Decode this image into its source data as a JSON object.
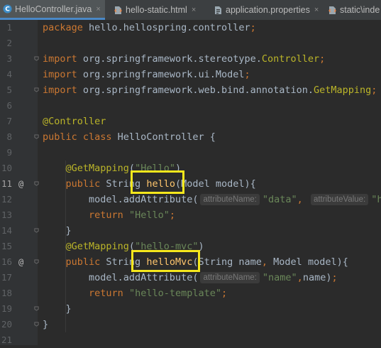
{
  "tabs": [
    {
      "label": "HelloController.java",
      "icon": "java-class-icon",
      "active": true
    },
    {
      "label": "hello-static.html",
      "icon": "html-file-icon",
      "active": false
    },
    {
      "label": "application.properties",
      "icon": "properties-file-icon",
      "active": false
    },
    {
      "label": "static\\inde",
      "icon": "html-file-icon",
      "active": false
    }
  ],
  "close_glyph": "×",
  "gutter_marker": "@",
  "colors": {
    "background": "#2b2b2b",
    "gutter": "#313335",
    "keyword": "#cc7832",
    "annotation": "#bbb529",
    "string": "#6a8759",
    "highlight_box": "#f5e71c",
    "active_tab_underline": "#4a88c7"
  },
  "lines": [
    {
      "n": "1",
      "tokens": [
        {
          "t": "package ",
          "c": "kw"
        },
        {
          "t": "hello.hellospring.controller",
          "c": ""
        },
        {
          "t": ";",
          "c": "kw"
        }
      ]
    },
    {
      "n": "2",
      "tokens": []
    },
    {
      "n": "3",
      "tokens": [
        {
          "t": "import ",
          "c": "kw"
        },
        {
          "t": "org.springframework.stereotype.",
          "c": ""
        },
        {
          "t": "Controller",
          "c": "ann"
        },
        {
          "t": ";",
          "c": "kw"
        }
      ]
    },
    {
      "n": "4",
      "tokens": [
        {
          "t": "import ",
          "c": "kw"
        },
        {
          "t": "org.springframework.ui.Model",
          "c": ""
        },
        {
          "t": ";",
          "c": "kw"
        }
      ]
    },
    {
      "n": "5",
      "tokens": [
        {
          "t": "import ",
          "c": "kw"
        },
        {
          "t": "org.springframework.web.bind.annotation.",
          "c": ""
        },
        {
          "t": "GetMapping",
          "c": "ann"
        },
        {
          "t": ";",
          "c": "kw"
        }
      ]
    },
    {
      "n": "6",
      "tokens": []
    },
    {
      "n": "7",
      "tokens": [
        {
          "t": "@Controller",
          "c": "ann"
        }
      ]
    },
    {
      "n": "8",
      "tokens": [
        {
          "t": "public class ",
          "c": "kw"
        },
        {
          "t": "HelloController ",
          "c": ""
        },
        {
          "t": "{",
          "c": ""
        }
      ]
    },
    {
      "n": "9",
      "tokens": []
    },
    {
      "n": "10",
      "tokens": [
        {
          "t": "    ",
          "c": ""
        },
        {
          "t": "@GetMapping",
          "c": "ann"
        },
        {
          "t": "(",
          "c": ""
        },
        {
          "t": "\"Hello\"",
          "c": "str"
        },
        {
          "t": ")",
          "c": ""
        }
      ]
    },
    {
      "n": "11",
      "tokens": [
        {
          "t": "    ",
          "c": ""
        },
        {
          "t": "public ",
          "c": "kw"
        },
        {
          "t": "String ",
          "c": ""
        },
        {
          "t": "hello",
          "c": "meth"
        },
        {
          "t": "(Model model){",
          "c": ""
        }
      ]
    },
    {
      "n": "12",
      "tokens": [
        {
          "t": "        model.addAttribute(",
          "c": ""
        },
        {
          "hint": "attributeName:"
        },
        {
          "t": "\"data\"",
          "c": "str"
        },
        {
          "t": ", ",
          "c": "kw"
        },
        {
          "hint": "attributeValue:"
        },
        {
          "t": "\"h",
          "c": "str"
        }
      ]
    },
    {
      "n": "13",
      "tokens": [
        {
          "t": "        ",
          "c": ""
        },
        {
          "t": "return ",
          "c": "kw"
        },
        {
          "t": "\"Hello\"",
          "c": "str"
        },
        {
          "t": ";",
          "c": "kw"
        }
      ]
    },
    {
      "n": "14",
      "tokens": [
        {
          "t": "    }",
          "c": ""
        }
      ]
    },
    {
      "n": "15",
      "tokens": [
        {
          "t": "    ",
          "c": ""
        },
        {
          "t": "@GetMapping",
          "c": "ann"
        },
        {
          "t": "(",
          "c": ""
        },
        {
          "t": "\"hello-mvc\"",
          "c": "str"
        },
        {
          "t": ")",
          "c": ""
        }
      ]
    },
    {
      "n": "16",
      "tokens": [
        {
          "t": "    ",
          "c": ""
        },
        {
          "t": "public ",
          "c": "kw"
        },
        {
          "t": "String ",
          "c": ""
        },
        {
          "t": "helloMvc",
          "c": "meth"
        },
        {
          "t": "(String name",
          "c": ""
        },
        {
          "t": ", ",
          "c": "kw"
        },
        {
          "t": "Model model){",
          "c": ""
        }
      ]
    },
    {
      "n": "17",
      "tokens": [
        {
          "t": "        model.addAttribute(",
          "c": ""
        },
        {
          "hint": "attributeName:"
        },
        {
          "t": "\"name\"",
          "c": "str"
        },
        {
          "t": ",",
          "c": "kw"
        },
        {
          "t": "name)",
          "c": ""
        },
        {
          "t": ";",
          "c": "kw"
        }
      ]
    },
    {
      "n": "18",
      "tokens": [
        {
          "t": "        ",
          "c": ""
        },
        {
          "t": "return ",
          "c": "kw"
        },
        {
          "t": "\"hello-template\"",
          "c": "str"
        },
        {
          "t": ";",
          "c": "kw"
        }
      ]
    },
    {
      "n": "19",
      "tokens": [
        {
          "t": "    }",
          "c": ""
        }
      ]
    },
    {
      "n": "20",
      "tokens": [
        {
          "t": "}",
          "c": ""
        }
      ]
    },
    {
      "n": "21",
      "tokens": []
    }
  ],
  "current_line": "11",
  "markers": [
    "11",
    "16"
  ],
  "folds": [
    "3",
    "5",
    "8",
    "11",
    "14",
    "16",
    "19",
    "20"
  ]
}
